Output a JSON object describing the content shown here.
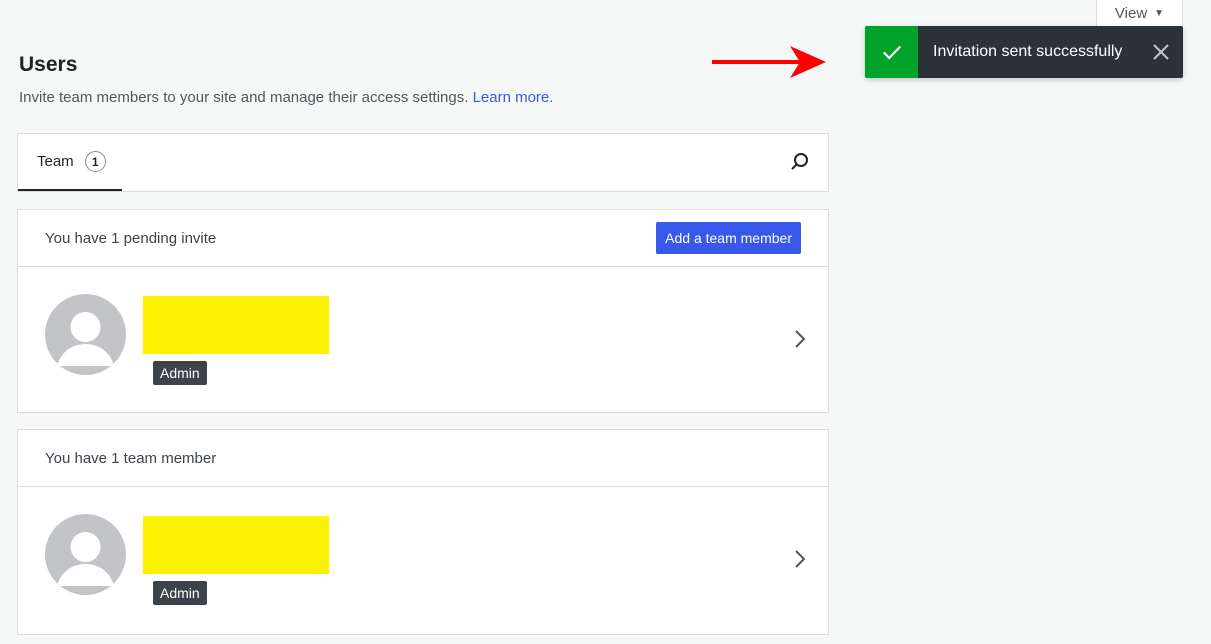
{
  "view_menu": {
    "label": "View",
    "icon": "caret-down-icon"
  },
  "header": {
    "title": "Users",
    "subtitle": "Invite team members to your site and manage their access settings.",
    "learn_more": "Learn more."
  },
  "notice": {
    "message": "Invitation sent successfully",
    "status_color": "#00a32a"
  },
  "tabs": [
    {
      "label": "Team",
      "count": "1"
    }
  ],
  "pending": {
    "heading": "You have 1 pending invite",
    "add_button": "Add a team member",
    "items": [
      {
        "role": "Admin"
      }
    ]
  },
  "members": {
    "heading": "You have 1 team member",
    "items": [
      {
        "role": "Admin"
      }
    ]
  },
  "colors": {
    "accent": "#3858e9",
    "annotation_arrow": "#ff0000",
    "redaction": "#fff200"
  }
}
